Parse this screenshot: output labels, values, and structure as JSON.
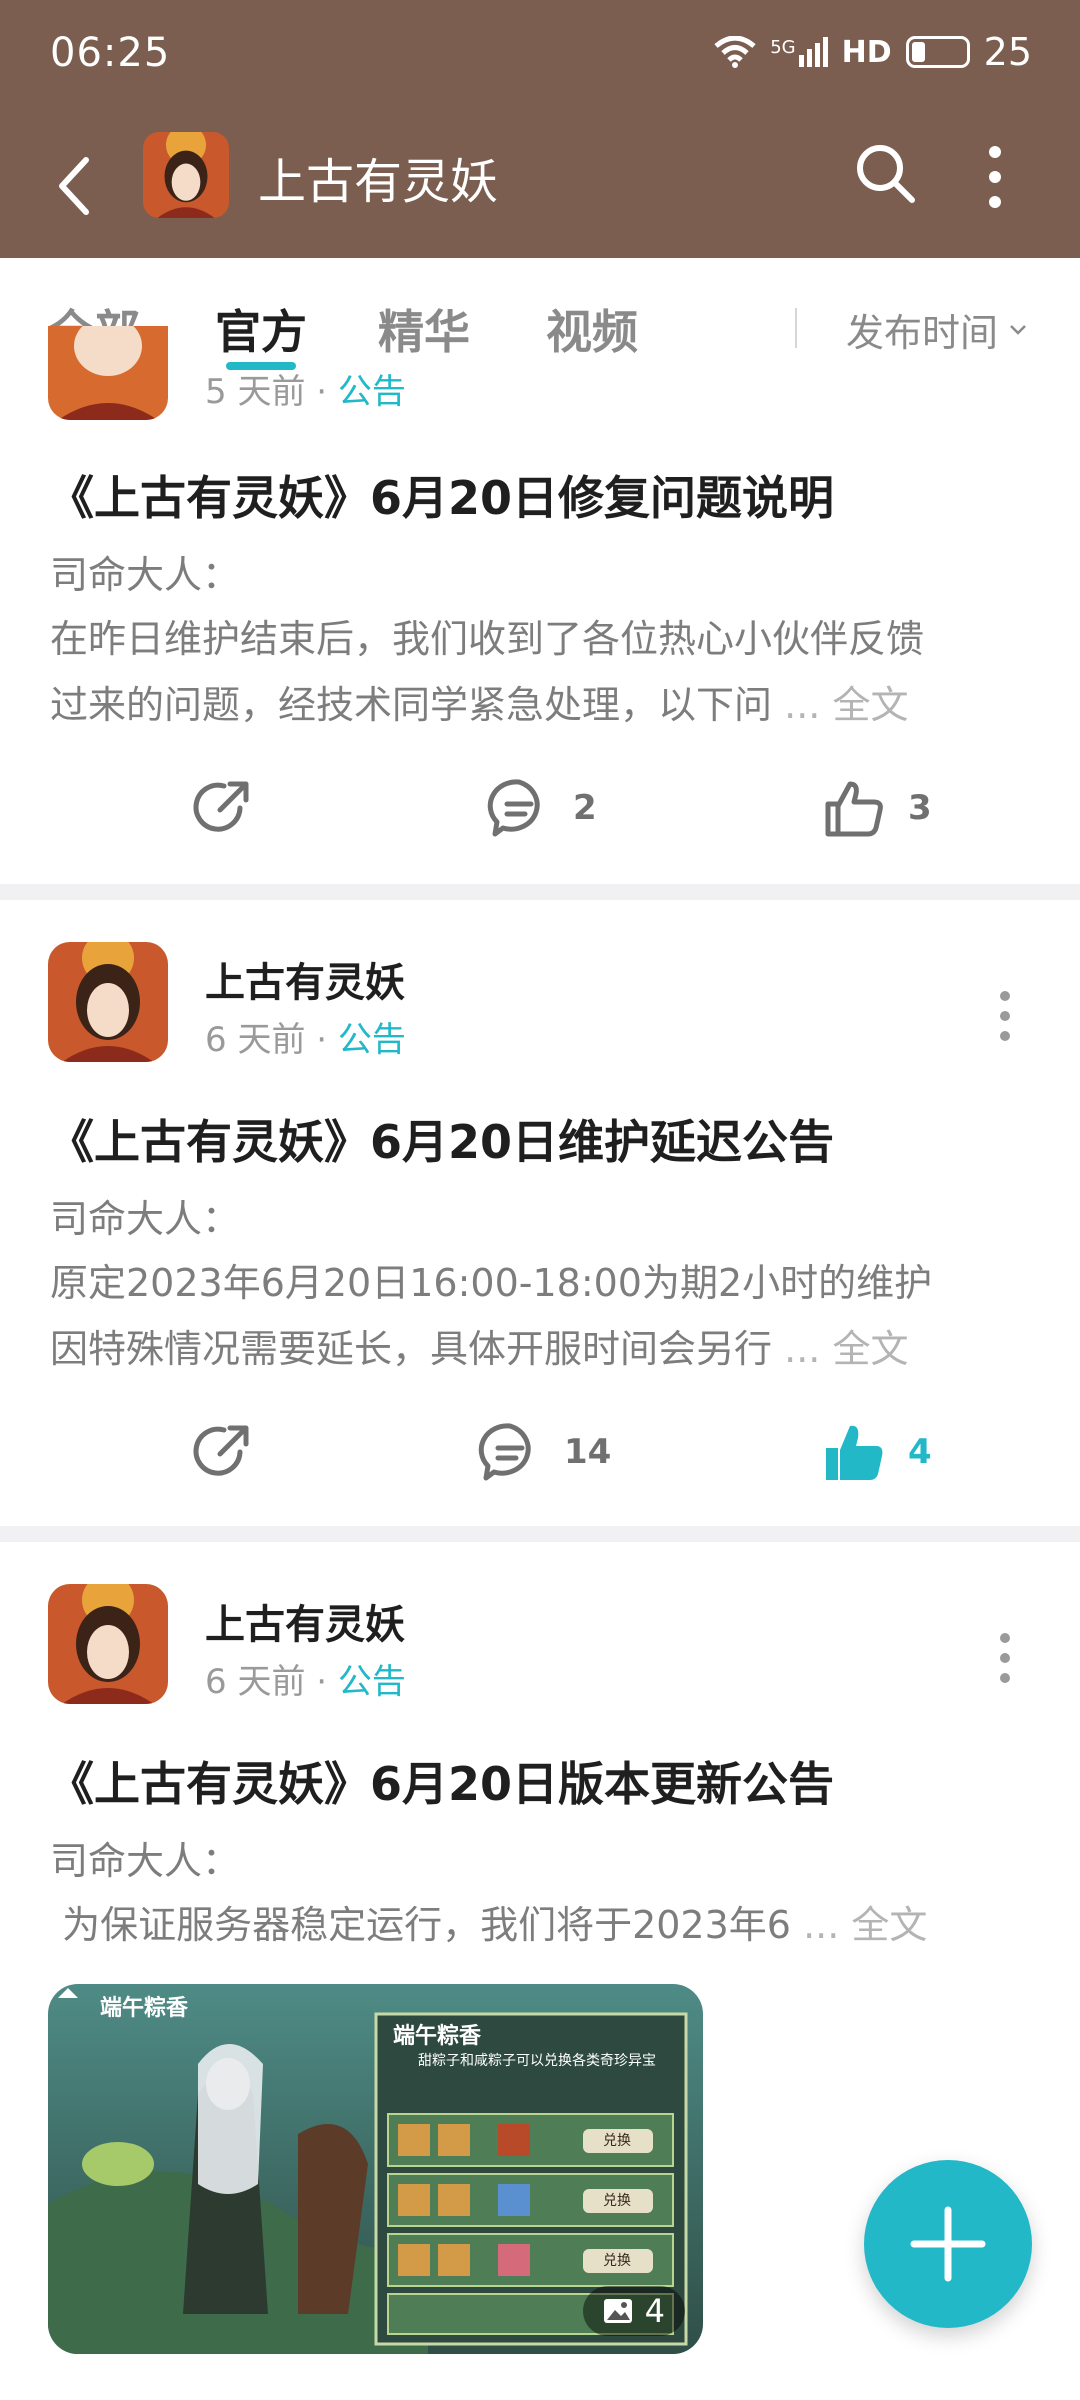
{
  "status_bar": {
    "time": "06:25",
    "network": "5G",
    "hd": "HD",
    "battery": "25"
  },
  "app_bar": {
    "title": "上古有灵妖"
  },
  "tabs": [
    {
      "label": "全部",
      "active": false
    },
    {
      "label": "官方",
      "active": true
    },
    {
      "label": "精华",
      "active": false
    },
    {
      "label": "视频",
      "active": false
    }
  ],
  "sort": {
    "label": "发布时间"
  },
  "posts": [
    {
      "time": "5 天前",
      "tag": "公告",
      "title": "《上古有灵妖》6月20日修复问题说明",
      "greeting": "司命大人：",
      "body_line1": "在昨日维护结束后，我们收到了各位热心小伙伴反馈",
      "body_line2": "过来的问题，经技术同学紧急处理，以下问",
      "ellipsis": "...",
      "full_text": "全文",
      "comments": "2",
      "likes": "3",
      "liked": false
    },
    {
      "author": "上古有灵妖",
      "time": "6 天前",
      "tag": "公告",
      "title": "《上古有灵妖》6月20日维护延迟公告",
      "greeting": "司命大人：",
      "body_line1": "原定2023年6月20日16:00-18:00为期2小时的维护",
      "body_line2": "因特殊情况需要延长，具体开服时间会另行",
      "ellipsis": "...",
      "full_text": "全文",
      "comments": "14",
      "likes": "4",
      "liked": true
    },
    {
      "author": "上古有灵妖",
      "time": "6 天前",
      "tag": "公告",
      "title": "《上古有灵妖》6月20日版本更新公告",
      "greeting": "司命大人：",
      "body_line1": " 为保证服务器稳定运行，我们将于2023年6",
      "ellipsis": "...",
      "full_text": "全文",
      "image_count": "4",
      "image_caption": "端午粽香",
      "image_subtitle": "甜粽子和咸粽子可以兑换各类奇珍异宝",
      "image_button": "兑换"
    }
  ],
  "colors": {
    "header": "#7b5e4f",
    "accent": "#22b8c8"
  },
  "icons": [
    "back-icon",
    "search-icon",
    "more-vertical-icon",
    "share-icon",
    "comment-icon",
    "like-icon",
    "add-icon",
    "image-icon"
  ]
}
